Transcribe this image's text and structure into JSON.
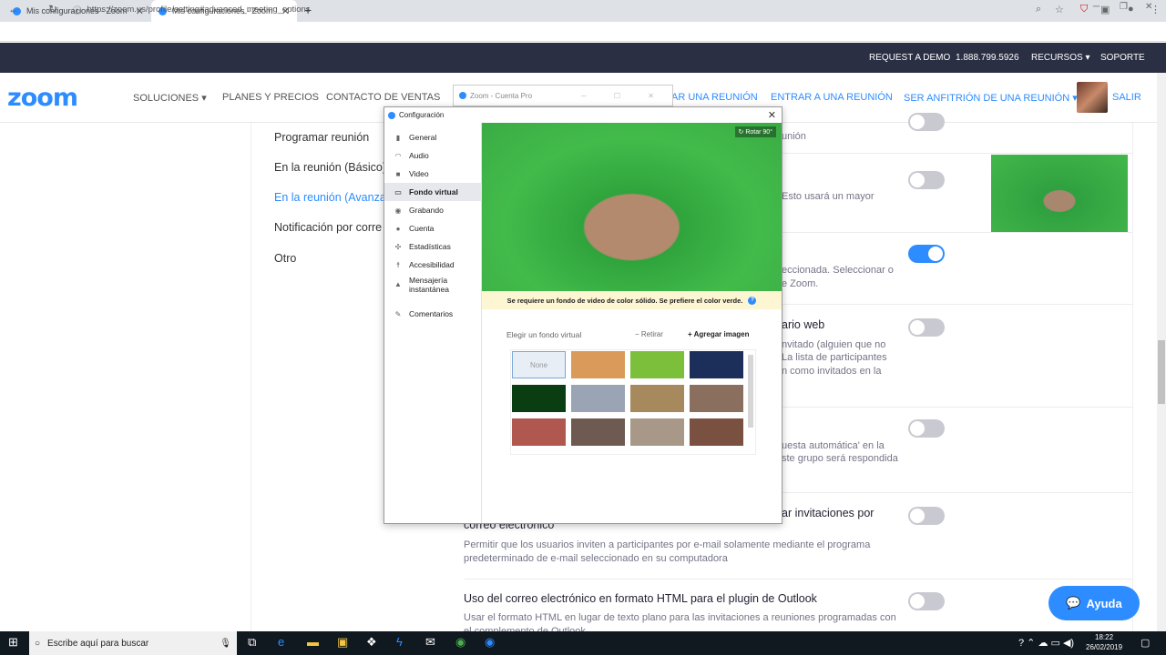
{
  "browser": {
    "tabs": [
      {
        "title": "Mis configuraciones - Zoom"
      },
      {
        "title": "Mis configuraciones - Zoom"
      }
    ],
    "url": "https://zoom.us/profile/setting#advanced_meeting_options"
  },
  "zoom_header": {
    "top_links": [
      "REQUEST A DEMO",
      "1.888.799.5926",
      "RECURSOS",
      "SOPORTE"
    ],
    "logo": "zoom",
    "nav": [
      "SOLUCIONES",
      "PLANES Y PRECIOS",
      "CONTACTO DE VENTAS"
    ],
    "actions": [
      "AR UNA REUNIÓN",
      "ENTRAR A UNA REUNIÓN",
      "SER ANFITRIÓN DE UNA REUNIÓN",
      "SALIR"
    ]
  },
  "settings_nav": {
    "items": [
      "Programar reunión",
      "En la reunión (Básico)",
      "En la reunión (Avanzad",
      "Notificación por corre",
      "Otro"
    ]
  },
  "settings_content": {
    "frag1": "unión",
    "frag2": "Esto usará un mayor",
    "frag3a": "eccionada. Seleccionar o",
    "frag3b": "e Zoom.",
    "frag4_title": "ario web",
    "frag4a": "nvitado (alguien que no",
    "frag4b": "La lista de participantes",
    "frag4c": "n como invitados en la",
    "frag5a": "uesta automática' en la",
    "frag5b": "ste grupo será respondida",
    "email_title_a": "ar invitaciones por",
    "email_title_b": "correo electrónico",
    "email_desc": "Permitir que los usuarios inviten a participantes por e-mail solamente mediante el programa predeterminado de e-mail seleccionado en su computadora",
    "html_title": "Uso del correo electrónico en formato HTML para el plugin de Outlook",
    "html_desc": "Usar el formato HTML en lugar de texto plano para las invitaciones a reuniones programadas con el complemento de Outlook"
  },
  "toggles": {
    "t1": false,
    "t2": false,
    "t3": true,
    "t4": false,
    "t5": false,
    "t6": false,
    "t7": false
  },
  "help_button": "Ayuda",
  "zoom_account_window": {
    "title": "Zoom - Cuenta Pro"
  },
  "config_window": {
    "title": "Configuración",
    "menu": [
      "General",
      "Audio",
      "Video",
      "Fondo virtual",
      "Grabando",
      "Cuenta",
      "Estadísticas",
      "Accesibilidad",
      "Mensajería instantánea",
      "Comentarios"
    ],
    "selected": "Fondo virtual",
    "rotate": "Rotar 90°",
    "warning": "Se requiere un fondo de video de color sólido. Se prefiere el color verde.",
    "choose_label": "Elegir un fondo virtual",
    "remove": "Retirar",
    "add_image": "Agregar imagen",
    "none_label": "None",
    "backgrounds": [
      {
        "name": "none",
        "color": "#e8eef6"
      },
      {
        "name": "golden-gate",
        "color": "#d99a5a"
      },
      {
        "name": "grass",
        "color": "#7cbf3a"
      },
      {
        "name": "earth-space",
        "color": "#1b2f5a"
      },
      {
        "name": "matrix",
        "color": "#0b3d12"
      },
      {
        "name": "office-photo",
        "color": "#9aa4b4"
      },
      {
        "name": "landscape",
        "color": "#a68a5e"
      },
      {
        "name": "group-photo-1",
        "color": "#8a6f5e"
      },
      {
        "name": "group-photo-2",
        "color": "#b0574f"
      },
      {
        "name": "selfie",
        "color": "#6e5a50"
      },
      {
        "name": "group-photo-3",
        "color": "#a89888"
      },
      {
        "name": "group-photo-4",
        "color": "#7a5040"
      }
    ]
  },
  "taskbar": {
    "search_placeholder": "Escribe aquí para buscar",
    "time": "18:22",
    "date": "26/02/2019"
  }
}
